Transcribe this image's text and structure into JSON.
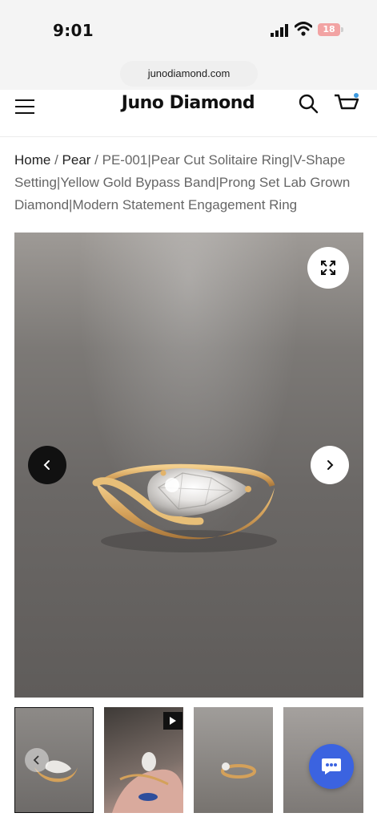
{
  "status_bar": {
    "time": "9:01",
    "battery": "18",
    "icons": [
      "signal-icon",
      "wifi-icon",
      "battery-icon"
    ]
  },
  "browser": {
    "url": "junodiamond.com"
  },
  "header": {
    "brand": "Juno Diamond",
    "icons": [
      "menu-icon",
      "search-icon",
      "cart-icon"
    ]
  },
  "breadcrumb": {
    "home": "Home",
    "sep1": " / ",
    "category": "Pear",
    "sep2": " / ",
    "current": "PE-001|Pear Cut Solitaire Ring|V-Shape Setting|Yellow Gold Bypass Band|Prong Set Lab Grown Diamond|Modern Statement Engagement Ring"
  },
  "gallery": {
    "controls": [
      "expand-icon",
      "chevron-left-icon",
      "chevron-right-icon"
    ],
    "thumbnails": [
      {
        "type": "image",
        "selected": true
      },
      {
        "type": "video",
        "selected": false
      },
      {
        "type": "image",
        "selected": false
      },
      {
        "type": "image",
        "selected": false
      }
    ]
  },
  "chat": {
    "icon": "chat-icon"
  },
  "colors": {
    "chat": "#3b63e0",
    "gold": "#d9a85c",
    "background": "#6b6866"
  }
}
